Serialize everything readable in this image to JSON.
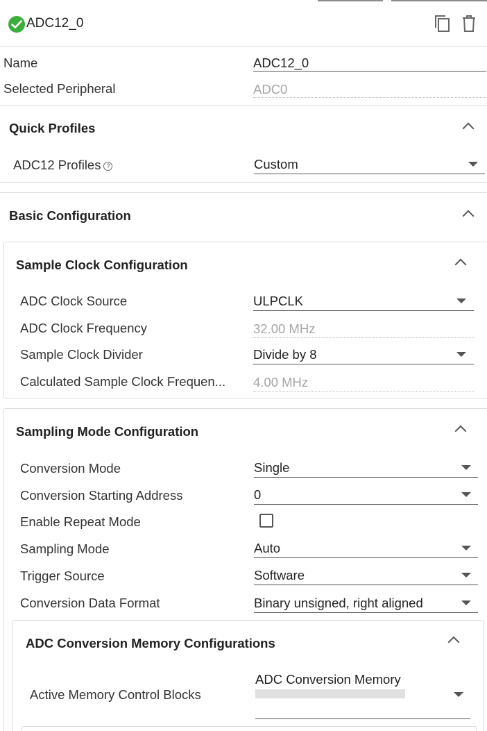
{
  "header": {
    "title": "ADC12_0"
  },
  "general": {
    "name_label": "Name",
    "name_value": "ADC12_0",
    "peripheral_label": "Selected Peripheral",
    "peripheral_value": "ADC0"
  },
  "quick_profiles": {
    "title": "Quick Profiles",
    "profile_label": "ADC12 Profiles",
    "profile_help": "?",
    "profile_value": "Custom"
  },
  "basic_configuration": {
    "title": "Basic Configuration"
  },
  "sample_clock": {
    "title": "Sample Clock Configuration",
    "clock_source_label": "ADC Clock Source",
    "clock_source_value": "ULPCLK",
    "clock_freq_label": "ADC Clock Frequency",
    "clock_freq_value": "32.00 MHz",
    "divider_label": "Sample Clock Divider",
    "divider_value": "Divide by 8",
    "calc_freq_label": "Calculated Sample Clock Frequen...",
    "calc_freq_value": "4.00 MHz"
  },
  "sampling_mode": {
    "title": "Sampling Mode Configuration",
    "conversion_mode_label": "Conversion Mode",
    "conversion_mode_value": "Single",
    "start_address_label": "Conversion Starting Address",
    "start_address_value": "0",
    "repeat_mode_label": "Enable Repeat Mode",
    "repeat_mode_checked": false,
    "sampling_mode_label": "Sampling Mode",
    "sampling_mode_value": "Auto",
    "trigger_label": "Trigger Source",
    "trigger_value": "Software",
    "data_format_label": "Conversion Data Format",
    "data_format_value": "Binary unsigned, right aligned"
  },
  "memory_config": {
    "title": "ADC Conversion Memory Configurations",
    "active_blocks_label": "Active Memory Control Blocks",
    "active_blocks_value": "ADC Conversion Memory"
  },
  "colors": {
    "accent_green": "#3cae3c"
  }
}
